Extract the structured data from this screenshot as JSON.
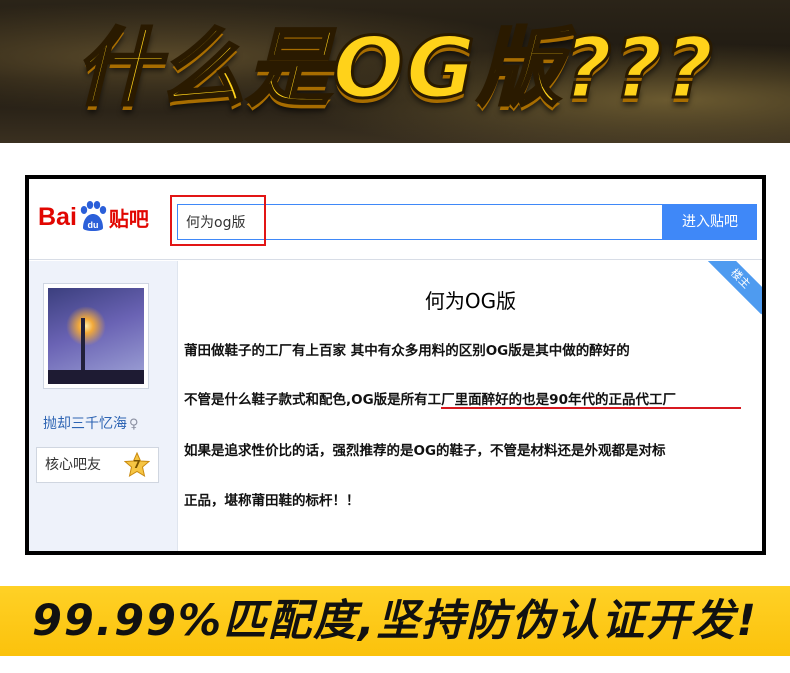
{
  "top_banner": {
    "headline": "什么是OG版???"
  },
  "forum": {
    "logo": {
      "bai": "Bai",
      "du": "du",
      "tieba": "贴吧"
    },
    "search": {
      "value": "何为og版"
    },
    "enter_button": "进入贴吧",
    "sidebar": {
      "username": "抛却三千忆海",
      "gender_icon": "female-icon",
      "member_label": "核心吧友",
      "level": "7",
      "op_ribbon": "楼主"
    },
    "post": {
      "title": "何为OG版",
      "lines": [
        "莆田做鞋子的工厂有上百家 其中有众多用料的区别OG版是其中做的醉好的",
        "不管是什么鞋子款式和配色,OG版是所有工厂里面醉好的也是90年代的正品代工厂",
        "如果是追求性价比的话，强烈推荐的是OG的鞋子，不管是材料还是外观都是对标",
        "正品，堪称莆田鞋的标杆！！"
      ]
    },
    "colors": {
      "accent_blue": "#3f88f8",
      "logo_red": "#e10601",
      "highlight_red": "#e21515"
    }
  },
  "bottom_banner": {
    "slogan": "99.99%匹配度,坚持防伪认证开发!"
  }
}
